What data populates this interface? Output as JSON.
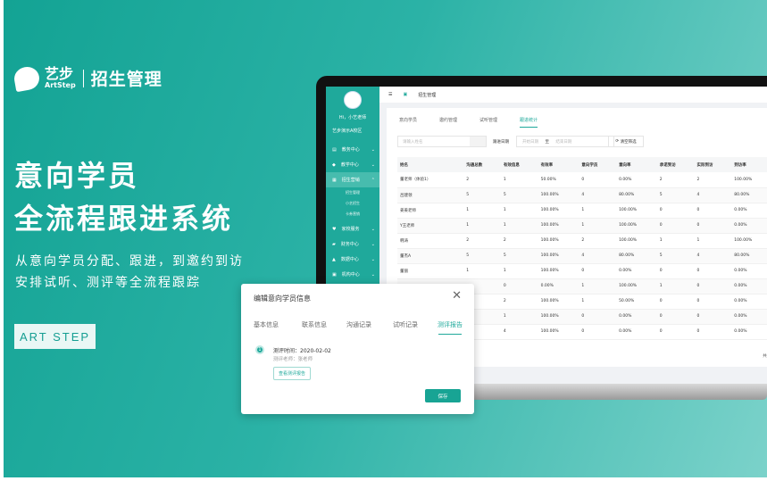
{
  "brand": {
    "cn": "艺步",
    "en": "ArtStep",
    "product": "招生管理"
  },
  "hero": {
    "line1": "意向学员",
    "line2": "全流程跟进系统",
    "desc1": "从意向学员分配、跟进，到邀约到访",
    "desc2": "安排试听、测评等全流程跟踪",
    "button": "ART STEP"
  },
  "colors": {
    "accent": "#1fa99b",
    "bg_start": "#13a394",
    "bg_end": "#7bd2ca"
  },
  "app": {
    "greeting": "Hi，小艺老师",
    "campus": "艺步演示A校区",
    "sidebar": [
      {
        "label": "教务中心",
        "icon": "book-icon"
      },
      {
        "label": "教学中心",
        "icon": "teach-icon"
      },
      {
        "label": "招生营销",
        "icon": "briefcase-icon",
        "active": true
      },
      {
        "label": "家校服务",
        "icon": "heart-icon"
      },
      {
        "label": "财务中心",
        "icon": "wallet-icon"
      },
      {
        "label": "数据中心",
        "icon": "chart-icon"
      },
      {
        "label": "机构中心",
        "icon": "org-icon"
      }
    ],
    "subitems": [
      "招生管理",
      "小艺招生",
      "卡券营销"
    ],
    "breadcrumb": "招生管理",
    "tabs": [
      "意向学员",
      "邀约管理",
      "试听管理",
      "跟进统计"
    ],
    "search_placeholder": "请输入姓名",
    "date_label": "跟进日期",
    "date_start": "开始日期",
    "date_to": "至",
    "date_end": "结束日期",
    "clear_button": "清空筛选",
    "columns": [
      "姓名",
      "沟通总数",
      "有效信息",
      "有效率",
      "意向学员",
      "意向率",
      "承诺到访",
      "实际到访",
      "到访率"
    ],
    "rows": [
      [
        "董老师（体验1）",
        "2",
        "1",
        "50.00%",
        "0",
        "0.00%",
        "2",
        "2",
        "100.00%"
      ],
      [
        "吕建领",
        "5",
        "5",
        "100.00%",
        "4",
        "80.00%",
        "5",
        "4",
        "80.00%"
      ],
      [
        "姜姜老师",
        "1",
        "1",
        "100.00%",
        "1",
        "100.00%",
        "0",
        "0",
        "0.00%"
      ],
      [
        "Y王老师",
        "1",
        "1",
        "100.00%",
        "1",
        "100.00%",
        "0",
        "0",
        "0.00%"
      ],
      [
        "韩涛",
        "2",
        "2",
        "100.00%",
        "2",
        "100.00%",
        "1",
        "1",
        "100.00%"
      ],
      [
        "董杰A",
        "5",
        "5",
        "100.00%",
        "4",
        "80.00%",
        "5",
        "4",
        "80.00%"
      ],
      [
        "董丽",
        "1",
        "1",
        "100.00%",
        "0",
        "0.00%",
        "0",
        "0",
        "0.00%"
      ],
      [
        "",
        "",
        "0",
        "0.00%",
        "1",
        "100.00%",
        "1",
        "0",
        "0.00%"
      ],
      [
        "",
        "",
        "2",
        "100.00%",
        "1",
        "50.00%",
        "0",
        "0",
        "0.00%"
      ],
      [
        "",
        "",
        "1",
        "100.00%",
        "0",
        "0.00%",
        "0",
        "0",
        "0.00%"
      ],
      [
        "",
        "",
        "4",
        "100.00%",
        "0",
        "0.00%",
        "0",
        "0",
        "0.00%"
      ]
    ],
    "total": "共 5"
  },
  "modal": {
    "title": "编辑意向学员信息",
    "tabs": [
      "基本信息",
      "联系信息",
      "沟通记录",
      "试听记录",
      "测评报告"
    ],
    "active_tab": 4,
    "step": "1",
    "eval_time": "测评时间：2020-02-02",
    "eval_teacher": "测评老师：张老师",
    "view_button": "查看测评报告",
    "save_button": "保存"
  }
}
